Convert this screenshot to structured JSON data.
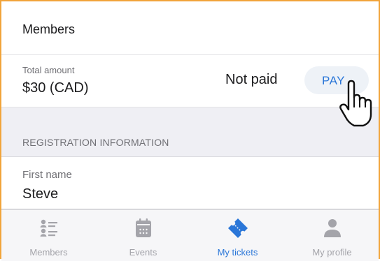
{
  "colors": {
    "accent": "#2a76d8",
    "inactive": "#a4a4aa",
    "section_bg": "#efeff4",
    "frame_border": "#f1a43a"
  },
  "members_section": {
    "title": "Members"
  },
  "payment": {
    "caption": "Total amount",
    "amount": "$30 (CAD)",
    "status": "Not paid",
    "button_label": "PAY"
  },
  "registration": {
    "section_title": "REGISTRATION INFORMATION",
    "first_name_label": "First name",
    "first_name_value": "Steve"
  },
  "tabbar": {
    "tabs": [
      {
        "label": "Members",
        "icon": "members-list-icon",
        "active": false
      },
      {
        "label": "Events",
        "icon": "calendar-icon",
        "active": false
      },
      {
        "label": "My tickets",
        "icon": "ticket-icon",
        "active": true
      },
      {
        "label": "My profile",
        "icon": "profile-icon",
        "active": false
      }
    ]
  },
  "cursor": {
    "icon": "hand-pointer-icon"
  }
}
